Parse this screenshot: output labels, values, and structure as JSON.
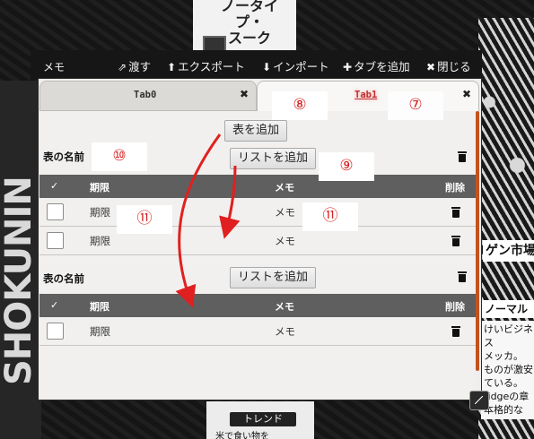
{
  "background": {
    "top_card": "ノータイプ・\nスーク",
    "vertical": "SHOKUNIN",
    "market": "ゲン市場",
    "normal": "ノーマル",
    "hand": "けいビジネス\nメッカ。\nものが激安\nている。\nridgeの章\n本格的な",
    "trend": "トレンド",
    "trend_sub": "米で食い物を"
  },
  "window": {
    "title": "メモ",
    "toolbar": {
      "pass": "渡す",
      "export": "エクスポート",
      "import": "インポート",
      "add_tab": "タブを追加",
      "close": "閉じる"
    }
  },
  "tabs": [
    {
      "label": "Tab0",
      "active": false
    },
    {
      "label": "Tab1",
      "active": true
    }
  ],
  "content": {
    "add_table": "表を追加",
    "tables": [
      {
        "name": "表の名前",
        "add_list": "リストを追加",
        "columns": {
          "check": "✓",
          "deadline": "期限",
          "memo": "メモ",
          "delete": "削除"
        },
        "rows": [
          {
            "deadline": "期限",
            "memo": "メモ"
          },
          {
            "deadline": "期限",
            "memo": "メモ"
          }
        ]
      },
      {
        "name": "表の名前",
        "add_list": "リストを追加",
        "columns": {
          "check": "✓",
          "deadline": "期限",
          "memo": "メモ",
          "delete": "削除"
        },
        "rows": [
          {
            "deadline": "期限",
            "memo": "メモ"
          }
        ]
      }
    ]
  },
  "annotations": {
    "n7": "⑦",
    "n8": "⑧",
    "n9": "⑨",
    "n10": "⑩",
    "n11a": "⑪",
    "n11b": "⑪"
  },
  "colors": {
    "accent_scroll": "#c1531f",
    "annotation_red": "#d82020",
    "header_gray": "#5f5f5f"
  }
}
